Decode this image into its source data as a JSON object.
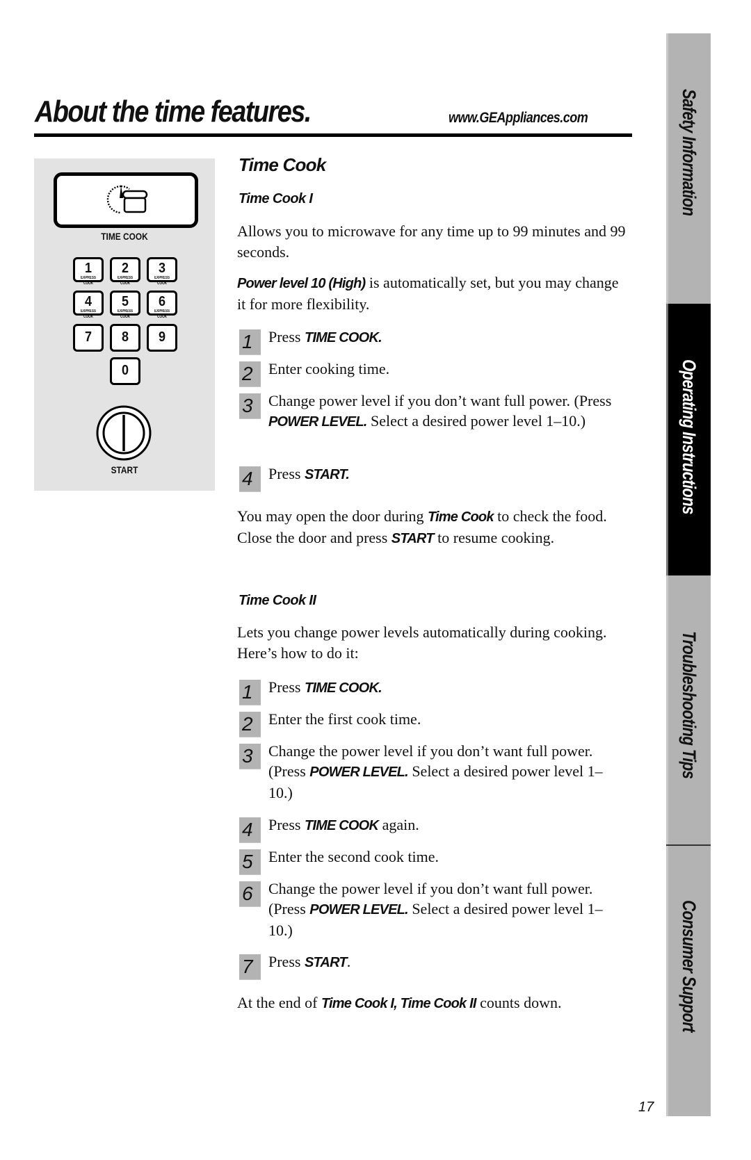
{
  "header": {
    "title": "About the time features.",
    "url": "www.GEAppliances.com"
  },
  "panel": {
    "display_icon": "clock-and-pot-icon",
    "time_cook_label": "TIME COOK",
    "keys": [
      {
        "num": "1",
        "sub": "EXPRESS COOK"
      },
      {
        "num": "2",
        "sub": "EXPRESS COOK"
      },
      {
        "num": "3",
        "sub": "EXPRESS COOK"
      },
      {
        "num": "4",
        "sub": "EXPRESS COOK"
      },
      {
        "num": "5",
        "sub": "EXPRESS COOK"
      },
      {
        "num": "6",
        "sub": "EXPRESS COOK"
      },
      {
        "num": "7"
      },
      {
        "num": "8"
      },
      {
        "num": "9"
      },
      {
        "num": "0"
      }
    ],
    "start_icon": "start-button-icon",
    "start_label": "START"
  },
  "content": {
    "section_title": "Time Cook",
    "tc1": {
      "heading": "Time Cook I",
      "intro": "Allows you to microwave for any time up to 99 minutes and 99 seconds.",
      "power_note_bold": "Power level 10 (High)",
      "power_note_rest": " is automatically set, but you may change it for more flexibility.",
      "steps": [
        {
          "n": "1",
          "pre": "Press ",
          "bold": "TIME COOK.",
          "post": ""
        },
        {
          "n": "2",
          "pre": "Enter cooking time.",
          "bold": "",
          "post": ""
        },
        {
          "n": "3",
          "pre": "Change power level if you don’t want full power. (Press ",
          "bold": "POWER LEVEL.",
          "post": " Select a desired power level 1–10.)"
        },
        {
          "n": "4",
          "pre": "Press ",
          "bold": "START.",
          "post": ""
        }
      ],
      "note_parts": [
        "You may open the door during ",
        "Time Cook",
        " to check the food. Close the door and press ",
        "START",
        " to resume cooking."
      ]
    },
    "tc2": {
      "heading": "Time Cook II",
      "intro": "Lets you change power levels automatically during cooking. Here’s how to do it:",
      "steps": [
        {
          "n": "1",
          "pre": "Press ",
          "bold": "TIME COOK.",
          "post": ""
        },
        {
          "n": "2",
          "pre": "Enter the first cook time.",
          "bold": "",
          "post": ""
        },
        {
          "n": "3",
          "pre": "Change the power level if you don’t want full power. (Press ",
          "bold": "POWER LEVEL.",
          "post": " Select a desired power level 1–10.)"
        },
        {
          "n": "4",
          "pre": "Press ",
          "bold": "TIME COOK",
          "post": " again."
        },
        {
          "n": "5",
          "pre": "Enter the second cook time.",
          "bold": "",
          "post": ""
        },
        {
          "n": "6",
          "pre": "Change the power level if you don’t want full power. (Press ",
          "bold": "POWER LEVEL.",
          "post": " Select a desired power level 1–10.)"
        },
        {
          "n": "7",
          "pre": "Press ",
          "bold": "START",
          "post": "."
        }
      ],
      "footer_parts": [
        "At the end of ",
        "Time Cook I, Time Cook II",
        " counts down."
      ]
    }
  },
  "sidebar": {
    "tabs": [
      {
        "label": "Safety Information",
        "active": false
      },
      {
        "label": "Operating Instructions",
        "active": true
      },
      {
        "label": "Troubleshooting Tips",
        "active": false
      },
      {
        "label": "Consumer Support",
        "active": false
      }
    ]
  },
  "page_number": "17"
}
